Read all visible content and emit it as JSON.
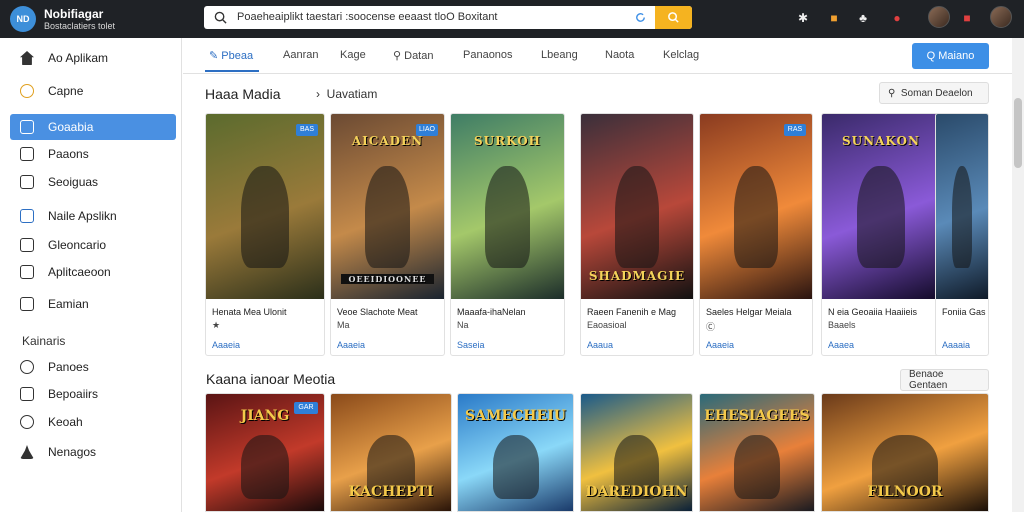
{
  "app": {
    "logo_text": "ND",
    "title": "Nobifiagar",
    "subtitle": "Bostaclatiers tolet"
  },
  "search": {
    "value": "Poaeheaiplikt taestari :soocense eeaast tloO Boxitant"
  },
  "sidebar": {
    "items": [
      {
        "label": "Ao Aplikam",
        "icon": "home-icon"
      },
      {
        "label": "Capne",
        "icon": "coin-icon"
      },
      {
        "label": "Goaabia",
        "icon": "box-icon",
        "active": true
      },
      {
        "label": "Paaons",
        "icon": "document-icon"
      },
      {
        "label": "Seoiguas",
        "icon": "grid-icon"
      },
      {
        "label": "Naile Apslikn",
        "icon": "monitor-icon"
      },
      {
        "label": "Gleoncario",
        "icon": "list-icon"
      },
      {
        "label": "Aplitcaeoon",
        "icon": "app-icon"
      },
      {
        "label": "Eamian",
        "icon": "folder-icon"
      }
    ],
    "section_header": "Kainaris",
    "section_items": [
      {
        "label": "Panoes",
        "icon": "b-icon"
      },
      {
        "label": "Bepoaiirs",
        "icon": "puzzle-icon"
      },
      {
        "label": "Keoah",
        "icon": "target-icon"
      },
      {
        "label": "Nenagos",
        "icon": "person-icon"
      }
    ]
  },
  "tabs": [
    {
      "label": "Pbeaa",
      "active": true
    },
    {
      "label": "Aanran"
    },
    {
      "label": "Kage"
    },
    {
      "label": "Datan"
    },
    {
      "label": "Panaonos"
    },
    {
      "label": "Lbeang"
    },
    {
      "label": "Naota"
    },
    {
      "label": "Kelclag"
    }
  ],
  "primary_button": "Q Maiano",
  "section1": {
    "title": "Haaa Madia",
    "subtitle": "Uavatiam",
    "button": "Soman Deaelon"
  },
  "cards": [
    {
      "name": "Henata Mea Ulonit",
      "meta": "★",
      "link": "Aaaeia",
      "badge": "BAS",
      "art_title": "",
      "colors": [
        "#5b6b2e",
        "#9a7a3a",
        "#2b2f1a"
      ]
    },
    {
      "name": "Veoe Slachote Meat",
      "meta": "Ma",
      "link": "Aaaeia",
      "badge": "LIAO",
      "art_title": "AICADEN",
      "footer": "OEEIDIOONEE",
      "colors": [
        "#6b4a33",
        "#c48a4a",
        "#1a2430"
      ]
    },
    {
      "name": "Maaafa-ihaNelan",
      "meta": "Na",
      "link": "Saseia",
      "badge": "",
      "art_title": "SURKOH",
      "colors": [
        "#3f7d66",
        "#a4c86a",
        "#1c2d2a"
      ]
    },
    {
      "name": "Raeen Fanenih e Mag",
      "meta": "Eaoasioal",
      "link": "Aaaua",
      "badge": "",
      "art_title": "SHADMAGIE",
      "colors": [
        "#3a2f3a",
        "#b8483a",
        "#111"
      ]
    },
    {
      "name": "Saeles Helgar Meiala",
      "meta": "Ⓒ",
      "link": "Aaaeia",
      "badge": "RAS",
      "art_title": "",
      "colors": [
        "#8a3b20",
        "#f08a3a",
        "#2a1410"
      ]
    },
    {
      "name": "N eia Geoaiia Haaiieis",
      "meta": "Baaels",
      "link": "Aaaea",
      "badge": "",
      "art_title": "SUNAKON",
      "colors": [
        "#3a2a6a",
        "#8a5ad8",
        "#120a28"
      ]
    },
    {
      "name": "Foniia Gas",
      "meta": "",
      "link": "Aaaaia",
      "badge": "",
      "art_title": "",
      "colors": [
        "#2a4a6a",
        "#5a8ab8",
        "#0f1a28"
      ]
    }
  ],
  "section2": {
    "title": "Kaana ianoar Meotia",
    "button": "Benaoe Gentaen"
  },
  "cards2": [
    {
      "art_title": "JIANG",
      "badge": "GAR",
      "colors": [
        "#5a1414",
        "#c23a2a",
        "#1a0a0a"
      ]
    },
    {
      "art_title": "KACHEPTI",
      "badge": "",
      "colors": [
        "#8a4a1a",
        "#e8a04a",
        "#2a1408"
      ]
    },
    {
      "art_title": "SAMECHEIU",
      "badge": "",
      "colors": [
        "#2a7ac8",
        "#8ad8f8",
        "#1a3a6a"
      ]
    },
    {
      "art_title": "DAREDIOHN",
      "badge": "",
      "colors": [
        "#1a5a8a",
        "#f0c040",
        "#0a2038"
      ]
    },
    {
      "art_title": "EHESIAGEES",
      "badge": "",
      "colors": [
        "#2a6a7a",
        "#e8803a",
        "#1a1a20"
      ]
    },
    {
      "art_title": "FILNOOR",
      "badge": "",
      "colors": [
        "#6a3a1a",
        "#f0a040",
        "#1a0f08"
      ]
    }
  ]
}
